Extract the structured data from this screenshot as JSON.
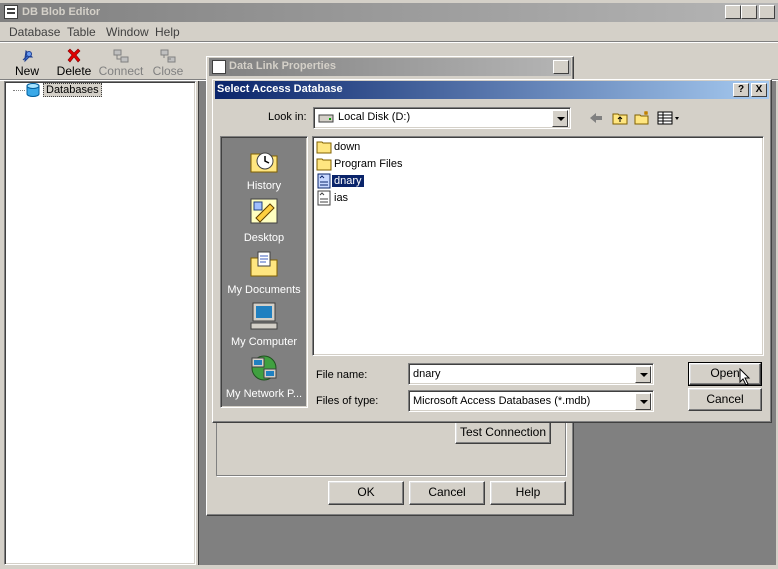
{
  "app": {
    "title": "DB Blob Editor",
    "menu": [
      "Database",
      "Table",
      "Window",
      "Help"
    ],
    "toolbar": [
      {
        "label": "New",
        "icon": "pin-icon",
        "enabled": true
      },
      {
        "label": "Delete",
        "icon": "red-x-icon",
        "enabled": true
      },
      {
        "label": "Connect",
        "icon": "connect-icon",
        "enabled": false
      },
      {
        "label": "Close",
        "icon": "disconnect-icon",
        "enabled": false
      }
    ],
    "tree": {
      "root_label": "Databases"
    }
  },
  "data_link": {
    "title": "Data Link Properties",
    "test_connection_label": "Test Connection",
    "ok_label": "OK",
    "cancel_label": "Cancel",
    "help_label": "Help"
  },
  "file_dialog": {
    "title": "Select Access Database",
    "help_caption": "?",
    "close_caption": "X",
    "look_in_label": "Look in:",
    "look_in_value": "Local Disk (D:)",
    "places": [
      "History",
      "Desktop",
      "My Documents",
      "My Computer",
      "My Network P..."
    ],
    "files": [
      {
        "name": "down",
        "type": "folder",
        "selected": false
      },
      {
        "name": "Program Files",
        "type": "folder",
        "selected": false
      },
      {
        "name": "dnary",
        "type": "mdb",
        "selected": true
      },
      {
        "name": "ias",
        "type": "mdb",
        "selected": false
      }
    ],
    "file_name_label": "File name:",
    "file_name_value": "dnary",
    "files_of_type_label": "Files of type:",
    "files_of_type_value": "Microsoft Access Databases (*.mdb)",
    "open_label": "Open",
    "cancel_label": "Cancel"
  },
  "colors": {
    "active_title": "#0a246a",
    "places_bar": "#808080",
    "selection": "#0a246a"
  }
}
